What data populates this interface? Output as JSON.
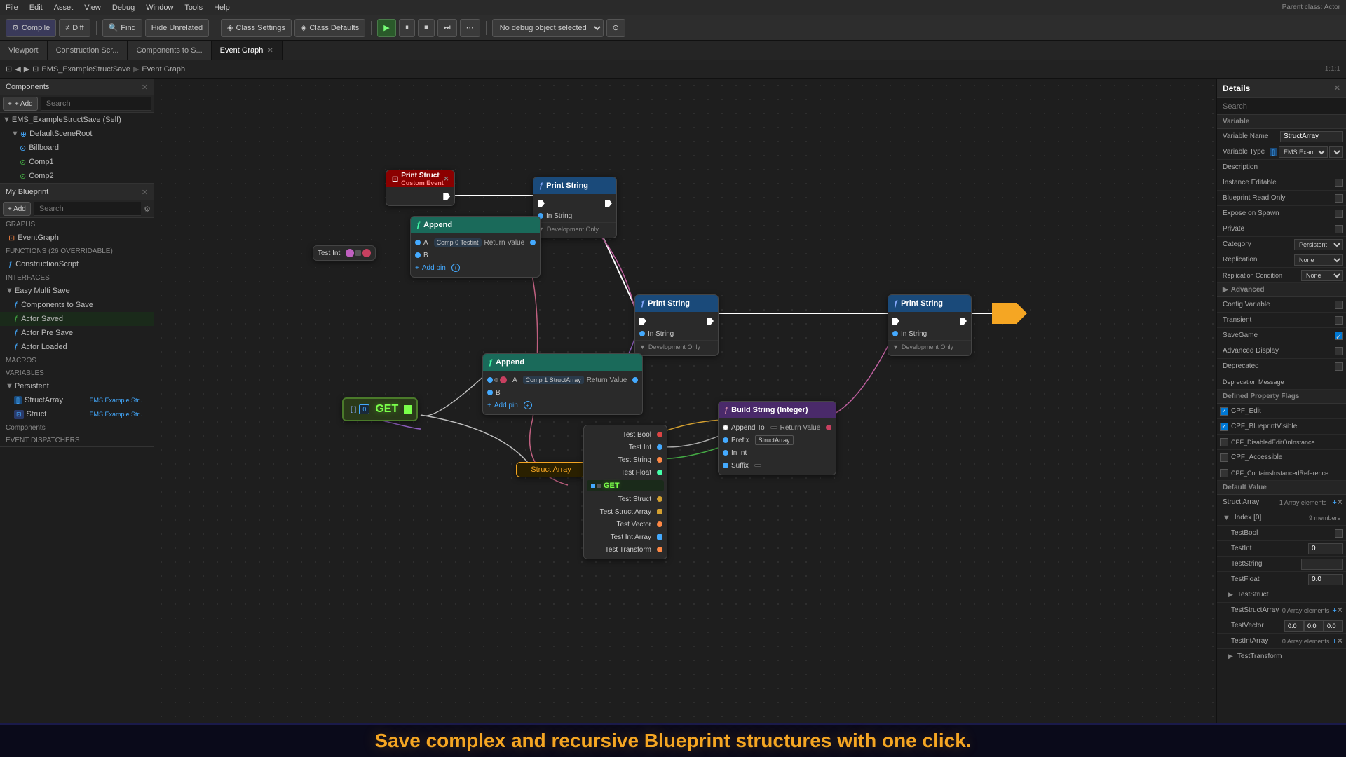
{
  "app": {
    "title": "EMS_ExampleStructSave",
    "tab_title": "EMS_ExampleStructSave*"
  },
  "menu": {
    "items": [
      "File",
      "Edit",
      "Asset",
      "View",
      "Debug",
      "Window",
      "Tools",
      "Help"
    ]
  },
  "toolbar": {
    "compile_label": "Compile",
    "diff_label": "Diff",
    "find_label": "Find",
    "hide_unrelated_label": "Hide Unrelated",
    "class_settings_label": "Class Settings",
    "class_defaults_label": "Class Defaults",
    "debug_placeholder": "No debug object selected",
    "parent_class": "Parent class: Actor"
  },
  "tabs": {
    "items": [
      "Viewport",
      "Construction Scr...",
      "Components to S...",
      "Event Graph"
    ]
  },
  "breadcrumb": {
    "parts": [
      "EMS_ExampleStructSave",
      "Event Graph"
    ]
  },
  "left_panel": {
    "components_header": "Components",
    "add_label": "+ Add",
    "search_placeholder": "Search",
    "self_label": "EMS_ExampleStructSave (Self)",
    "scene_root": "DefaultSceneRoot",
    "billboard": "Billboard",
    "comp1": "Comp1",
    "comp2": "Comp2",
    "my_blueprint_header": "My Blueprint",
    "graphs_header": "GRAPHS",
    "event_graph": "EventGraph",
    "functions_header": "FUNCTIONS (26 OVERRIDABLE)",
    "construction_script": "ConstructionScript",
    "interfaces_header": "INTERFACES",
    "easy_multi_save": "Easy Multi Save",
    "components_to_save": "Components to Save",
    "actor_saved": "Actor Saved",
    "actor_pre_save": "Actor Pre Save",
    "actor_loaded": "Actor Loaded",
    "macros_header": "MACROS",
    "variables_header": "VARIABLES",
    "persistent_header": "Persistent",
    "struct_array_var": "StructArray",
    "struct_array_type": "EMS Example Stru...",
    "struct_var": "Struct",
    "struct_type": "EMS Example Stru...",
    "components_sub": "Components",
    "event_dispatchers": "EVENT DISPATCHERS"
  },
  "nodes": {
    "print_struct": {
      "title": "Print Struct",
      "subtitle": "Custom Event",
      "exec_in": "",
      "exec_out": ""
    },
    "print_string_1": {
      "title": "Print String",
      "in_string": "In String",
      "development_only": "Development Only"
    },
    "append_1": {
      "title": "Append",
      "a_label": "A",
      "a_value": "Comp 0 Testint",
      "b_label": "B",
      "return_value": "Return Value",
      "add_pin": "Add pin"
    },
    "test_int": {
      "label": "Test Int"
    },
    "print_string_2": {
      "title": "Print String",
      "in_string": "In String",
      "development_only": "Development Only"
    },
    "append_2": {
      "title": "Append",
      "a_label": "A",
      "a_value": "Comp 1 StructArray",
      "b_label": "B",
      "return_value": "Return Value",
      "add_pin": "Add pin"
    },
    "print_string_3": {
      "title": "Print String",
      "in_string": "In String",
      "development_only": "Development Only"
    },
    "print_string_4": {
      "title": "Print String",
      "in_string": "In String",
      "development_only": "Development Only"
    },
    "get_node": {
      "label": "GET"
    },
    "get_node_2": {
      "label": "GET"
    },
    "struct_array_node": {
      "label": "Struct Array"
    },
    "build_string": {
      "title": "Build String (Integer)",
      "append_to": "Append To",
      "return_value": "Return Value",
      "prefix": "Prefix",
      "prefix_value": "StructArray",
      "in_int": "In Int",
      "suffix": "Suffix"
    },
    "struct_detail": {
      "test_bool": "Test Bool",
      "test_int": "Test Int",
      "test_string": "Test String",
      "test_float": "Test Float",
      "get_struct": "GET",
      "test_struct": "Test Struct",
      "test_struct_array": "Test Struct Array",
      "test_vector": "Test Vector",
      "test_int_array": "Test Int Array",
      "test_transform": "Test Transform"
    }
  },
  "details_panel": {
    "title": "Details",
    "search_placeholder": "Search",
    "variable_section": "Variable",
    "variable_name_label": "Variable Name",
    "variable_name_value": "StructArray",
    "variable_type_label": "Variable Type",
    "variable_type_value": "EMS Example ...",
    "description_label": "Description",
    "instance_editable_label": "Instance Editable",
    "blueprint_read_only_label": "Blueprint Read Only",
    "expose_on_spawn_label": "Expose on Spawn",
    "private_label": "Private",
    "category_label": "Category",
    "category_value": "Persistent",
    "replication_label": "Replication",
    "replication_value": "None",
    "replication_condition_label": "Replication Condition",
    "replication_condition_value": "None",
    "advanced_section": "Advanced",
    "config_variable_label": "Config Variable",
    "transient_label": "Transient",
    "save_game_label": "SaveGame",
    "advanced_display_label": "Advanced Display",
    "deprecated_label": "Deprecated",
    "deprecation_message_label": "Deprecation Message",
    "defined_property_flags": "Defined Property Flags",
    "cpp_edit": "CPF_Edit",
    "cpp_blueprint_visible": "CPF_BlueprintVisible",
    "cpp_disabled": "CPF_DisabledEditOnInstance",
    "cpp_accessible": "CPF_Accessible",
    "cpp_contains": "CPF_ContainsInstancedReference",
    "default_value_section": "Default Value",
    "struct_array_label": "Struct Array",
    "struct_array_count": "1 Array elements",
    "index_label": "Index [0]",
    "index_count": "9 members",
    "test_bool_label": "TestBool",
    "testint_label": "TestInt",
    "testint_value": "0",
    "teststring_label": "TestString",
    "testfloat_label": "TestFloat",
    "testfloat_value": "0.0",
    "teststruct_label": "TestStruct",
    "teststruct_array_label": "TestStructArray",
    "teststruct_array_count": "0 Array elements",
    "testvector_label": "TestVector",
    "testvector_x": "0.0",
    "testvector_y": "0.0",
    "testvector_z": "0.0",
    "testintarray_label": "TestIntArray",
    "testintarray_count": "0 Array elements",
    "testtransform_label": "TestTransform"
  },
  "bottom_bar": {
    "text": "Save complex and recursive Blueprint structures with one click."
  },
  "icons": {
    "compile": "⚙",
    "diff": "≠",
    "find": "🔍",
    "play": "▶",
    "pause": "⏸",
    "stop": "⏹",
    "close": "✕",
    "arrow_right": "▶",
    "arrow_down": "▼",
    "settings": "⚙",
    "add": "+",
    "arrow": "►"
  }
}
